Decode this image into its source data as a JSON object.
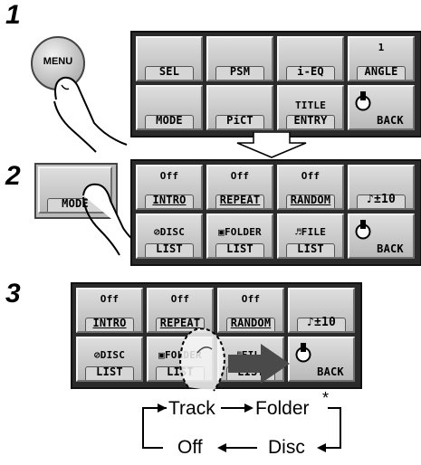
{
  "steps": [
    "1",
    "2",
    "3"
  ],
  "menu_button": "MENU",
  "menu_grid": {
    "row1": [
      "SEL",
      "PSM",
      "i-EQ"
    ],
    "angle": {
      "top": "1",
      "label": "ANGLE"
    },
    "row2": [
      "MODE",
      "PiCT"
    ],
    "title_entry": [
      "TITLE",
      "ENTRY"
    ],
    "back": "BACK"
  },
  "mode_button": "MODE",
  "mode_grid": {
    "off": "Off",
    "intro": "INTRO",
    "repeat": "REPEAT",
    "random": "RANDOM",
    "skip": "♪±10",
    "disc": [
      "DISC",
      "LIST"
    ],
    "folder": [
      "FOLDER",
      "LIST"
    ],
    "file": [
      "FILE",
      "LIST"
    ],
    "back": "BACK"
  },
  "sequence": {
    "track": "Track",
    "folder": "Folder",
    "note_mark": "*",
    "off": "Off",
    "disc": "Disc"
  }
}
